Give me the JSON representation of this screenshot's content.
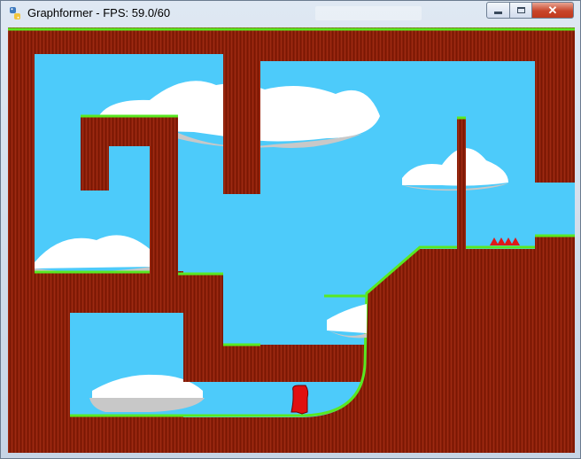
{
  "window": {
    "title": "Graphformer - FPS: 59.0/60",
    "ghost_title": "",
    "icon": "python-icon",
    "controls": {
      "minimize_icon": "minimize-icon",
      "maximize_icon": "maximize-icon",
      "close_icon": "close-icon"
    }
  },
  "game": {
    "colors": {
      "sky": "#4dcbfa",
      "wall": "#8a1e08",
      "wall_stripe": "#a83318",
      "grass": "#59e821",
      "cloud_white": "#ffffff",
      "cloud_shadow": "#c8c8c8",
      "spike": "#e01818",
      "player": "#e01010"
    },
    "objects": [
      "sky",
      "terrain",
      "grass-edges",
      "clouds",
      "pillar",
      "spikes",
      "player-character"
    ]
  }
}
